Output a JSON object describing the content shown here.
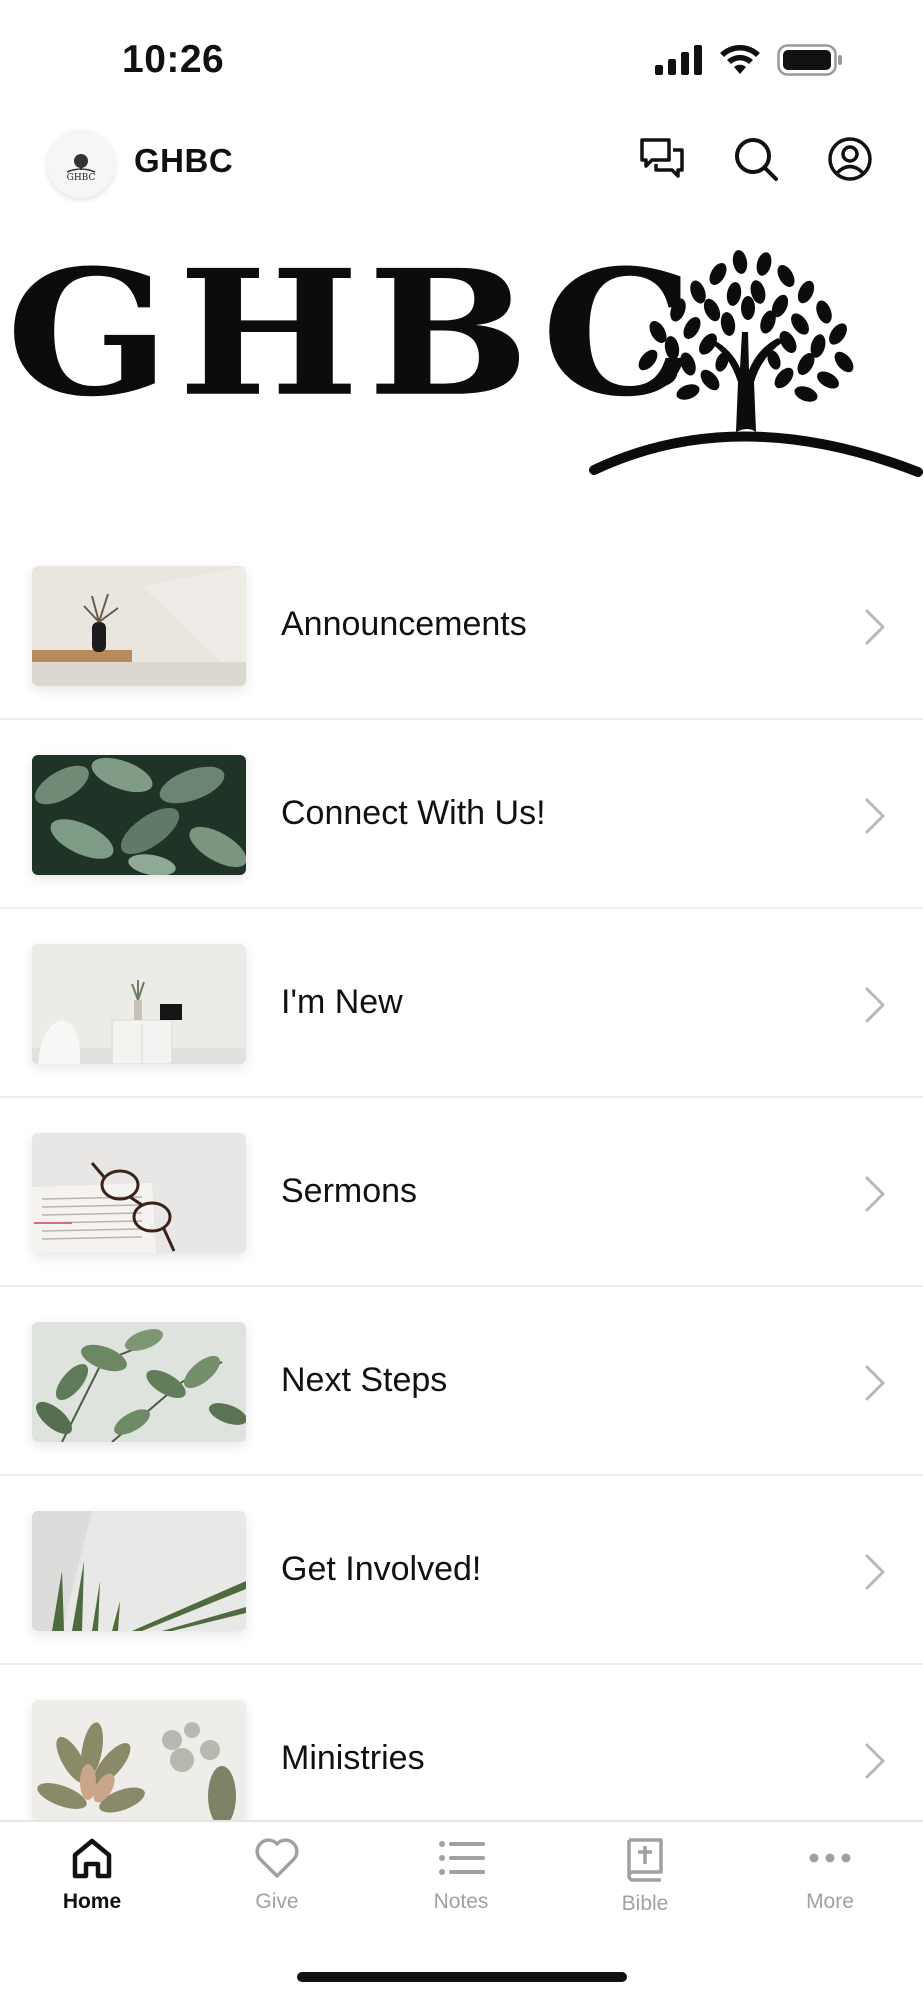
{
  "status_bar": {
    "time": "10:26",
    "signal_icon": "cellular-signal-icon",
    "wifi_icon": "wifi-icon",
    "battery_icon": "battery-icon"
  },
  "header": {
    "title": "GHBC",
    "logo_text": "GHBC",
    "actions": [
      {
        "icon": "chat-bubbles-icon"
      },
      {
        "icon": "search-icon"
      },
      {
        "icon": "profile-icon"
      }
    ]
  },
  "banner": {
    "text": "GHBC",
    "logo_icon": "tree-on-hill-icon"
  },
  "menu": {
    "items": [
      {
        "label": "Announcements",
        "image": "vase-on-shelf"
      },
      {
        "label": "Connect With Us!",
        "image": "green-leaves"
      },
      {
        "label": "I'm New",
        "image": "white-desk-plant"
      },
      {
        "label": "Sermons",
        "image": "glasses-on-book"
      },
      {
        "label": "Next Steps",
        "image": "plant-leaves"
      },
      {
        "label": "Get Involved!",
        "image": "palm-fronds"
      },
      {
        "label": "Ministries",
        "image": "succulents"
      }
    ]
  },
  "tabs": [
    {
      "label": "Home",
      "icon": "home-icon",
      "active": true
    },
    {
      "label": "Give",
      "icon": "heart-icon",
      "active": false
    },
    {
      "label": "Notes",
      "icon": "list-icon",
      "active": false
    },
    {
      "label": "Bible",
      "icon": "bible-icon",
      "active": false
    },
    {
      "label": "More",
      "icon": "more-dots-icon",
      "active": false
    }
  ],
  "colors": {
    "text": "#111111",
    "inactive_tab": "#a1a1a1",
    "divider": "#ececec",
    "chevron": "#b8b8b8"
  }
}
